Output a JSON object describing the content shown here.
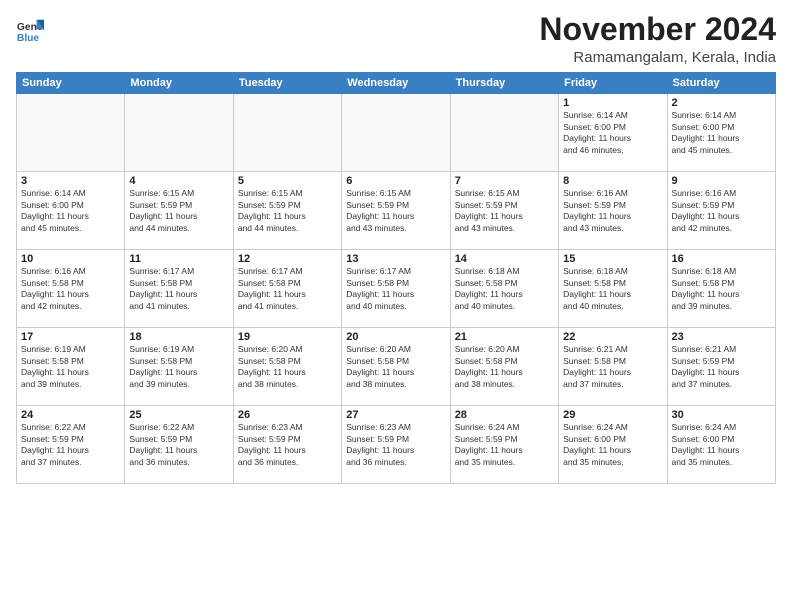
{
  "logo": {
    "general": "General",
    "blue": "Blue"
  },
  "title": "November 2024",
  "location": "Ramamangalam, Kerala, India",
  "days_of_week": [
    "Sunday",
    "Monday",
    "Tuesday",
    "Wednesday",
    "Thursday",
    "Friday",
    "Saturday"
  ],
  "weeks": [
    [
      {
        "day": "",
        "info": ""
      },
      {
        "day": "",
        "info": ""
      },
      {
        "day": "",
        "info": ""
      },
      {
        "day": "",
        "info": ""
      },
      {
        "day": "",
        "info": ""
      },
      {
        "day": "1",
        "info": "Sunrise: 6:14 AM\nSunset: 6:00 PM\nDaylight: 11 hours\nand 46 minutes."
      },
      {
        "day": "2",
        "info": "Sunrise: 6:14 AM\nSunset: 6:00 PM\nDaylight: 11 hours\nand 45 minutes."
      }
    ],
    [
      {
        "day": "3",
        "info": "Sunrise: 6:14 AM\nSunset: 6:00 PM\nDaylight: 11 hours\nand 45 minutes."
      },
      {
        "day": "4",
        "info": "Sunrise: 6:15 AM\nSunset: 5:59 PM\nDaylight: 11 hours\nand 44 minutes."
      },
      {
        "day": "5",
        "info": "Sunrise: 6:15 AM\nSunset: 5:59 PM\nDaylight: 11 hours\nand 44 minutes."
      },
      {
        "day": "6",
        "info": "Sunrise: 6:15 AM\nSunset: 5:59 PM\nDaylight: 11 hours\nand 43 minutes."
      },
      {
        "day": "7",
        "info": "Sunrise: 6:15 AM\nSunset: 5:59 PM\nDaylight: 11 hours\nand 43 minutes."
      },
      {
        "day": "8",
        "info": "Sunrise: 6:16 AM\nSunset: 5:59 PM\nDaylight: 11 hours\nand 43 minutes."
      },
      {
        "day": "9",
        "info": "Sunrise: 6:16 AM\nSunset: 5:59 PM\nDaylight: 11 hours\nand 42 minutes."
      }
    ],
    [
      {
        "day": "10",
        "info": "Sunrise: 6:16 AM\nSunset: 5:58 PM\nDaylight: 11 hours\nand 42 minutes."
      },
      {
        "day": "11",
        "info": "Sunrise: 6:17 AM\nSunset: 5:58 PM\nDaylight: 11 hours\nand 41 minutes."
      },
      {
        "day": "12",
        "info": "Sunrise: 6:17 AM\nSunset: 5:58 PM\nDaylight: 11 hours\nand 41 minutes."
      },
      {
        "day": "13",
        "info": "Sunrise: 6:17 AM\nSunset: 5:58 PM\nDaylight: 11 hours\nand 40 minutes."
      },
      {
        "day": "14",
        "info": "Sunrise: 6:18 AM\nSunset: 5:58 PM\nDaylight: 11 hours\nand 40 minutes."
      },
      {
        "day": "15",
        "info": "Sunrise: 6:18 AM\nSunset: 5:58 PM\nDaylight: 11 hours\nand 40 minutes."
      },
      {
        "day": "16",
        "info": "Sunrise: 6:18 AM\nSunset: 5:58 PM\nDaylight: 11 hours\nand 39 minutes."
      }
    ],
    [
      {
        "day": "17",
        "info": "Sunrise: 6:19 AM\nSunset: 5:58 PM\nDaylight: 11 hours\nand 39 minutes."
      },
      {
        "day": "18",
        "info": "Sunrise: 6:19 AM\nSunset: 5:58 PM\nDaylight: 11 hours\nand 39 minutes."
      },
      {
        "day": "19",
        "info": "Sunrise: 6:20 AM\nSunset: 5:58 PM\nDaylight: 11 hours\nand 38 minutes."
      },
      {
        "day": "20",
        "info": "Sunrise: 6:20 AM\nSunset: 5:58 PM\nDaylight: 11 hours\nand 38 minutes."
      },
      {
        "day": "21",
        "info": "Sunrise: 6:20 AM\nSunset: 5:58 PM\nDaylight: 11 hours\nand 38 minutes."
      },
      {
        "day": "22",
        "info": "Sunrise: 6:21 AM\nSunset: 5:58 PM\nDaylight: 11 hours\nand 37 minutes."
      },
      {
        "day": "23",
        "info": "Sunrise: 6:21 AM\nSunset: 5:59 PM\nDaylight: 11 hours\nand 37 minutes."
      }
    ],
    [
      {
        "day": "24",
        "info": "Sunrise: 6:22 AM\nSunset: 5:59 PM\nDaylight: 11 hours\nand 37 minutes."
      },
      {
        "day": "25",
        "info": "Sunrise: 6:22 AM\nSunset: 5:59 PM\nDaylight: 11 hours\nand 36 minutes."
      },
      {
        "day": "26",
        "info": "Sunrise: 6:23 AM\nSunset: 5:59 PM\nDaylight: 11 hours\nand 36 minutes."
      },
      {
        "day": "27",
        "info": "Sunrise: 6:23 AM\nSunset: 5:59 PM\nDaylight: 11 hours\nand 36 minutes."
      },
      {
        "day": "28",
        "info": "Sunrise: 6:24 AM\nSunset: 5:59 PM\nDaylight: 11 hours\nand 35 minutes."
      },
      {
        "day": "29",
        "info": "Sunrise: 6:24 AM\nSunset: 6:00 PM\nDaylight: 11 hours\nand 35 minutes."
      },
      {
        "day": "30",
        "info": "Sunrise: 6:24 AM\nSunset: 6:00 PM\nDaylight: 11 hours\nand 35 minutes."
      }
    ]
  ]
}
